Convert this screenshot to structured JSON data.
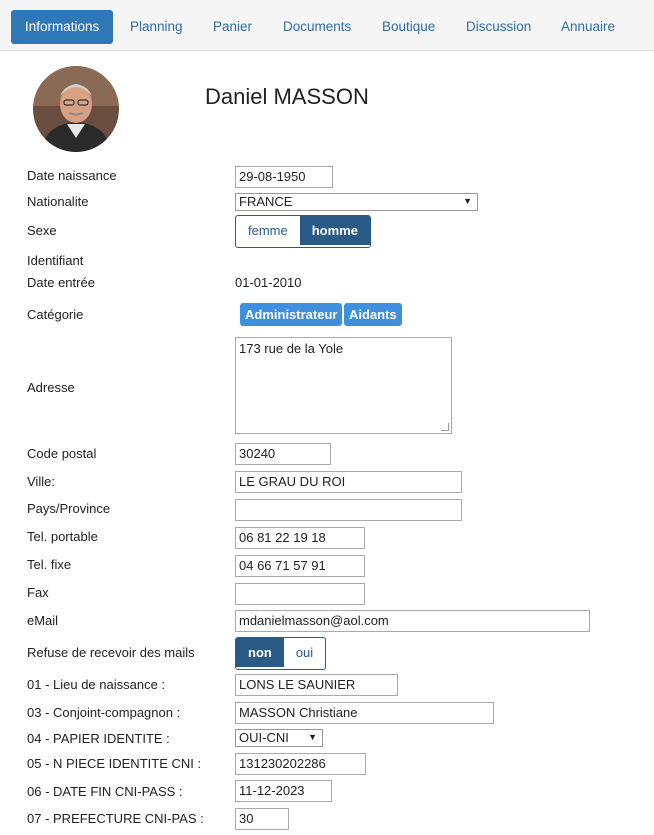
{
  "tabs": [
    "Informations",
    "Planning",
    "Panier",
    "Documents",
    "Boutique",
    "Discussion",
    "Annuaire"
  ],
  "profile": {
    "name": "Daniel MASSON"
  },
  "labels": {
    "birth": "Date naissance",
    "nationality": "Nationalite",
    "sex": "Sexe",
    "identifier": "Identifiant",
    "entry": "Date entrée",
    "category": "Catégorie",
    "address": "Adresse",
    "postal": "Code postal",
    "city": "Ville:",
    "country": "Pays/Province",
    "mobile": "Tel. portable",
    "phone": "Tel. fixe",
    "fax": "Fax",
    "email": "eMail",
    "refuse_mail": "Refuse de recevoir des mails",
    "birthplace": "01 - Lieu de naissance :",
    "spouse": "03 - Conjoint-compagnon :",
    "id_paper": "04 - PAPIER IDENTITE :",
    "id_number": "05 - N PIECE IDENTITE CNI :",
    "id_end": "06 - DATE FIN CNI-PASS :",
    "prefecture": "07 - PREFECTURE CNI-PAS :"
  },
  "values": {
    "birth": "29-08-1950",
    "nationality": "FRANCE",
    "sex_female": "femme",
    "sex_male": "homme",
    "entry": "01-01-2010",
    "category_admin": "Administrateur",
    "category_aidants": "Aidants",
    "address": "173 rue de la Yole",
    "postal": "30240",
    "city": "LE GRAU DU ROI",
    "country": "",
    "mobile": "06 81 22 19 18",
    "phone": "04 66 71 57 91",
    "fax": "",
    "email": "mdanielmasson@aol.com",
    "mail_no": "non",
    "mail_yes": "oui",
    "birthplace": "LONS LE SAUNIER",
    "spouse": "MASSON Christiane",
    "id_paper": "OUI-CNI",
    "id_number": "131230202286",
    "id_end": "11-12-2023",
    "prefecture": "30"
  },
  "state": {
    "active_tab": "Informations",
    "sex_selected": "homme",
    "refuse_mail_selected": "non"
  },
  "colors": {
    "tab_active": "#2f78b7",
    "toggle_on": "#2a5b86",
    "badge": "#3e8fe0"
  }
}
